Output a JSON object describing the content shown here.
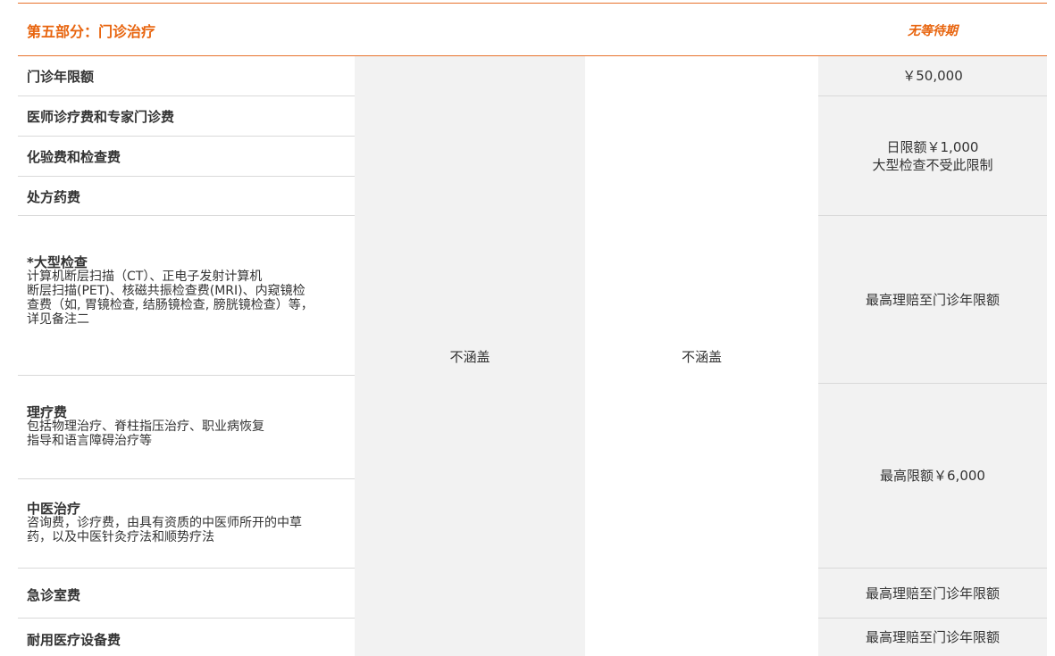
{
  "section": {
    "title": "第五部分：门诊治疗",
    "waiting_period": "无等待期"
  },
  "rows": [
    {
      "title": "门诊年限额"
    },
    {
      "title": "医师诊疗费和专家门诊费"
    },
    {
      "title": "化验费和检查费"
    },
    {
      "title": "处方药费"
    },
    {
      "title": "*大型检查",
      "desc": [
        "计算机断层扫描（CT）、正电子发射计算机",
        "断层扫描(PET)、核磁共振检查费(MRI)、内窥镜检",
        "查费（如, 胃镜检查, 结肠镜检查, 膀胱镜检查）等，",
        "详见备注二"
      ]
    },
    {
      "title": "理疗费",
      "desc": [
        "包括物理治疗、脊柱指压治疗、职业病恢复",
        "指导和语言障碍治疗等"
      ]
    },
    {
      "title": "中医治疗",
      "desc": [
        "咨询费，诊疗费，由具有资质的中医师所开的中草",
        "药，以及中医针灸疗法和顺势疗法"
      ]
    },
    {
      "title": "急诊室费"
    },
    {
      "title": "耐用医疗设备费"
    }
  ],
  "plan_columns": {
    "col1_value": "不涵盖",
    "col2_value": "不涵盖"
  },
  "col3": {
    "annual_limit": "￥50,000",
    "daily_limit_line1": "日限额￥1,000",
    "daily_limit_line2": "大型检查不受此限制",
    "max_to_annual_1": "最高理赔至门诊年限额",
    "max_6000": "最高限额￥6,000",
    "max_to_annual_2": "最高理赔至门诊年限额",
    "max_to_annual_3": "最高理赔至门诊年限额"
  },
  "colors": {
    "accent": "#e8650f",
    "cell_bg": "#f2f2f2",
    "divider": "#d9d9d9"
  }
}
